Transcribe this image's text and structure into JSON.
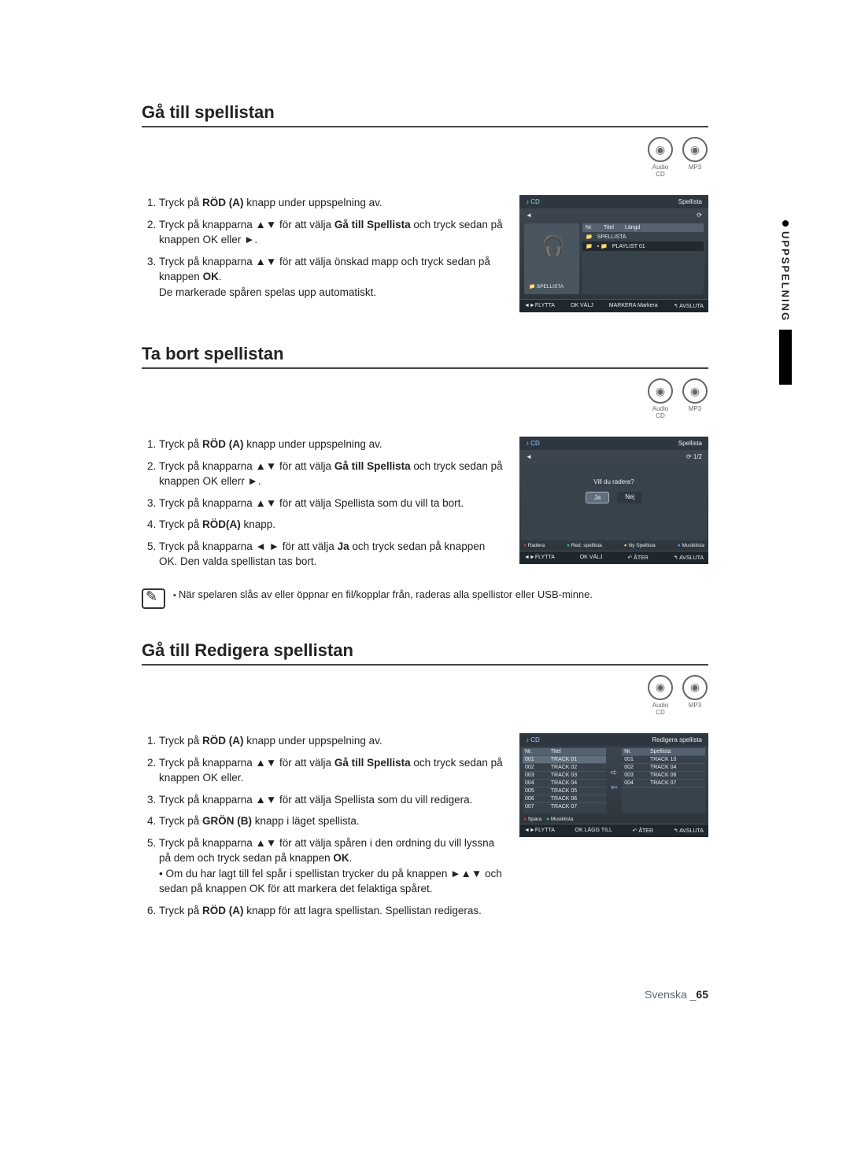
{
  "side_tab": {
    "label": "UPPSPELNING"
  },
  "badges": {
    "audio": "Audio CD",
    "mp3": "MP3"
  },
  "section1": {
    "title": "Gå till spellistan",
    "steps": [
      {
        "pre": "Tryck på ",
        "bold": "RÖD (A)",
        "post": " knapp under uppspelning av."
      },
      {
        "pre": "Tryck på knapparna ▲▼ för att välja ",
        "bold": "Gå till Spellista",
        "post": " och tryck sedan på knappen OK eller ►."
      },
      {
        "pre": "Tryck på knapparna ▲▼ för att välja önskad mapp och tryck sedan på knappen ",
        "bold": "OK",
        "post": ".\nDe markerade spåren spelas upp automatiskt."
      }
    ]
  },
  "section2": {
    "title": "Ta bort spellistan",
    "steps": [
      {
        "pre": "Tryck på ",
        "bold": "RÖD (A)",
        "post": " knapp under uppspelning av."
      },
      {
        "pre": "Tryck på knapparna ▲▼ för att välja ",
        "bold": "Gå till Spellista",
        "post": " och tryck sedan på knappen OK ellerr ►."
      },
      {
        "pre": "Tryck på knapparna ▲▼ för att välja Spellista som du vill ta bort.",
        "bold": "",
        "post": ""
      },
      {
        "pre": "Tryck på ",
        "bold": "RÖD(A)",
        "post": " knapp."
      },
      {
        "pre": "Tryck på knapparna ◄ ► för att välja ",
        "bold": "Ja",
        "post": " och tryck sedan på knappen OK. Den valda spellistan tas bort."
      }
    ],
    "note": "När spelaren slås av eller öppnar en fil/kopplar från, raderas alla spellistor eller USB-minne."
  },
  "section3": {
    "title": "Gå till Redigera spellistan",
    "steps": [
      {
        "pre": "Tryck på ",
        "bold": "RÖD (A)",
        "post": " knapp under uppspelning av."
      },
      {
        "pre": "Tryck på knapparna ▲▼ för att välja ",
        "bold": "Gå till Spellista",
        "post": " och tryck sedan på knappen OK eller."
      },
      {
        "pre": "Tryck på knapparna ▲▼ för att välja Spellista som du vill redigera.",
        "bold": "",
        "post": ""
      },
      {
        "pre": "Tryck på ",
        "bold": "GRÖN (B)",
        "post": " knapp i läget spellista."
      },
      {
        "pre": "Tryck på knapparna ▲▼ för att välja spåren i den ordning du vill lyssna på dem och tryck sedan på knappen ",
        "bold": "OK",
        "post": ".\n• Om du har lagt till fel spår i spellistan trycker du på knappen ►▲▼ och sedan på knappen OK för att markera det felaktiga spåret."
      },
      {
        "pre": "Tryck på ",
        "bold": "RÖD (A)",
        "post": " knapp för att lagra spellistan. Spellistan redigeras."
      }
    ]
  },
  "thumb1": {
    "head_left": "CD",
    "head_right": "Spellista",
    "list_hdr": {
      "nr": "Nr.",
      "titel": "Titel",
      "langd": "Längd"
    },
    "items": [
      "SPELLISTA",
      "PLAYLIST 01"
    ],
    "left_caption": "SPELLISTA",
    "foot": {
      "a": "◄►FLYTTA",
      "b": "OK VÄLJ",
      "c": "MARKERA Markera",
      "d": "↰ AVSLUTA"
    }
  },
  "thumb2": {
    "head_left": "CD",
    "head_right": "Spellista",
    "counter": "1/2",
    "question": "Vill du radera?",
    "btn_yes": "Ja",
    "btn_no": "Nej",
    "colors": {
      "r": "Radera",
      "g": "Red. spellista",
      "y": "Ny Spellista",
      "b": "Musiklista"
    },
    "foot": {
      "a": "◄►FLYTTA",
      "b": "OK VÄLJ",
      "c": "↶ ÅTER",
      "d": "↰ AVSLUTA"
    }
  },
  "thumb3": {
    "head_left": "CD",
    "head_right": "Redigera spellista",
    "left_hdr": {
      "nr": "Nr.",
      "titel": "Titel"
    },
    "right_hdr": {
      "nr": "Nr.",
      "titel": "Spellista"
    },
    "left_rows": [
      [
        "001",
        "TRACK 01"
      ],
      [
        "002",
        "TRACK 02"
      ],
      [
        "003",
        "TRACK 03"
      ],
      [
        "004",
        "TRACK 04"
      ],
      [
        "005",
        "TRACK 05"
      ],
      [
        "006",
        "TRACK 06"
      ],
      [
        "007",
        "TRACK 07"
      ]
    ],
    "right_rows": [
      [
        "001",
        "TRACK 10"
      ],
      [
        "002",
        "TRACK 04"
      ],
      [
        "003",
        "TRACK 06"
      ],
      [
        "004",
        "TRACK 07"
      ]
    ],
    "colors": {
      "r": "Spara",
      "g": "Musiklista"
    },
    "foot": {
      "a": "◄►FLYTTA",
      "b": "OK LÄGG TILL",
      "c": "↶ ÅTER",
      "d": "↰ AVSLUTA"
    }
  },
  "footer": {
    "lang": "Svenska ",
    "page": "65"
  }
}
